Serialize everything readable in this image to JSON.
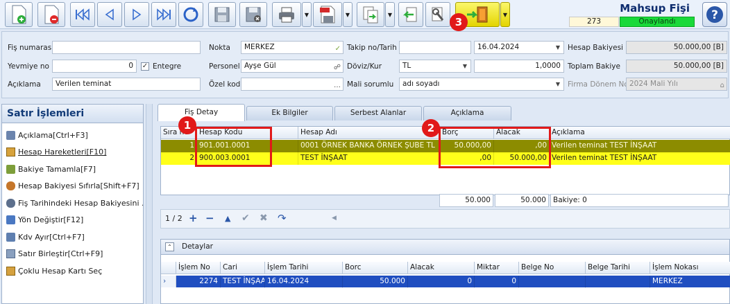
{
  "toolbar": {
    "icons": [
      "new-document-icon",
      "delete-document-icon",
      "first-record-icon",
      "previous-record-icon",
      "next-record-icon",
      "last-record-icon",
      "refresh-icon",
      "save-icon",
      "save-cancel-icon",
      "print-icon",
      "pdf-export-icon",
      "transfer-icon",
      "return-icon",
      "tools-icon",
      "exit-door-icon"
    ],
    "title": "Mahsup Fişi",
    "doc_number": "273",
    "status": "Onaylandı",
    "status_color": "#19d93a"
  },
  "form": {
    "fis_numarasi": {
      "label": "Fiş numarası",
      "value": ""
    },
    "yevmiye": {
      "label": "Yevmiye no",
      "value": "0",
      "entegre_label": "Entegre",
      "entegre_checked": true
    },
    "aciklama": {
      "label": "Açıklama",
      "value": "Verilen teminat"
    },
    "nokta": {
      "label": "Nokta",
      "value": "MERKEZ"
    },
    "personel": {
      "label": "Personel",
      "value": "Ayşe Gül"
    },
    "ozel_kod": {
      "label": "Özel kod",
      "value": ""
    },
    "takip": {
      "label": "Takip no/Tarih",
      "value": "",
      "date": "16.04.2024"
    },
    "doviz": {
      "label": "Döviz/Kur",
      "currency": "TL",
      "rate": "1,0000"
    },
    "mali_sorumlu": {
      "label": "Mali sorumlu",
      "value": "adı soyadı"
    },
    "hesap_bakiyesi": {
      "label": "Hesap Bakiyesi",
      "value": "50.000,00 [B]"
    },
    "toplam_bakiye": {
      "label": "Toplam Bakiye",
      "value": "50.000,00 [B]"
    },
    "firma_donem": {
      "label": "Firma Dönem No",
      "value": "2024 Mali Yılı"
    }
  },
  "sidebar": {
    "title": "Satır İşlemleri",
    "items": [
      {
        "label": "Açıklama[Ctrl+F3]"
      },
      {
        "label": "Hesap Hareketleri[F10]"
      },
      {
        "label": "Bakiye Tamamla[F7]"
      },
      {
        "label": "Hesap Bakiyesi Sıfırla[Shift+F7]"
      },
      {
        "label": "Fiş Tarihindeki Hesap Bakiyesini ..."
      },
      {
        "label": "Yön Değiştir[F12]"
      },
      {
        "label": "Kdv Ayır[Ctrl+F7]"
      },
      {
        "label": "Satır Birleştir[Ctrl+F9]"
      },
      {
        "label": "Çoklu Hesap Kartı Seç"
      }
    ]
  },
  "tabs": [
    "Fiş Detay",
    "Ek Bilgiler",
    "Serbest Alanlar",
    "Açıklama"
  ],
  "grid": {
    "headers": [
      "Sıra no",
      "Hesap Kodu",
      "Hesap Adı",
      "Borç",
      "Alacak",
      "Açıklama"
    ],
    "rows": [
      {
        "sira": "1",
        "kod": "901.001.0001",
        "ad": "0001 ÖRNEK BANKA ÖRNEK ŞUBE TL",
        "borc": "50.000,00",
        "alacak": ",00",
        "aciklama": "Verilen teminat TEST İNŞAAT"
      },
      {
        "sira": "2",
        "kod": "900.003.0001",
        "ad": "TEST İNŞAAT",
        "borc": ",00",
        "alacak": "50.000,00",
        "aciklama": "Verilen teminat TEST İNŞAAT"
      }
    ],
    "totals": {
      "borc": "50.000",
      "alacak": "50.000",
      "bakiye": "Bakiye: 0"
    },
    "pager": "1 / 2"
  },
  "details": {
    "title": "Detaylar",
    "headers": [
      "İşlem No",
      "Cari",
      "İşlem Tarihi",
      "Borc",
      "Alacak",
      "Miktar",
      "Belge No",
      "Belge Tarihi",
      "İşlem Nokası"
    ],
    "row": {
      "islem_no": "2274",
      "cari": "TEST İNŞAA",
      "tarih": "16.04.2024",
      "borc": "50.000",
      "alacak": "0",
      "miktar": "0",
      "belge_no": "",
      "belge_tarihi": "",
      "nokta": "MERKEZ"
    }
  },
  "annotations": {
    "badge1": "1",
    "badge2": "2",
    "badge3": "3"
  },
  "colors": {
    "row1_bg": "#8c8c00",
    "row2_bg": "#ffff1a",
    "selected_row_bg": "#1f4ec0",
    "annotation_red": "#e11919",
    "accent_blue": "#123b78"
  }
}
